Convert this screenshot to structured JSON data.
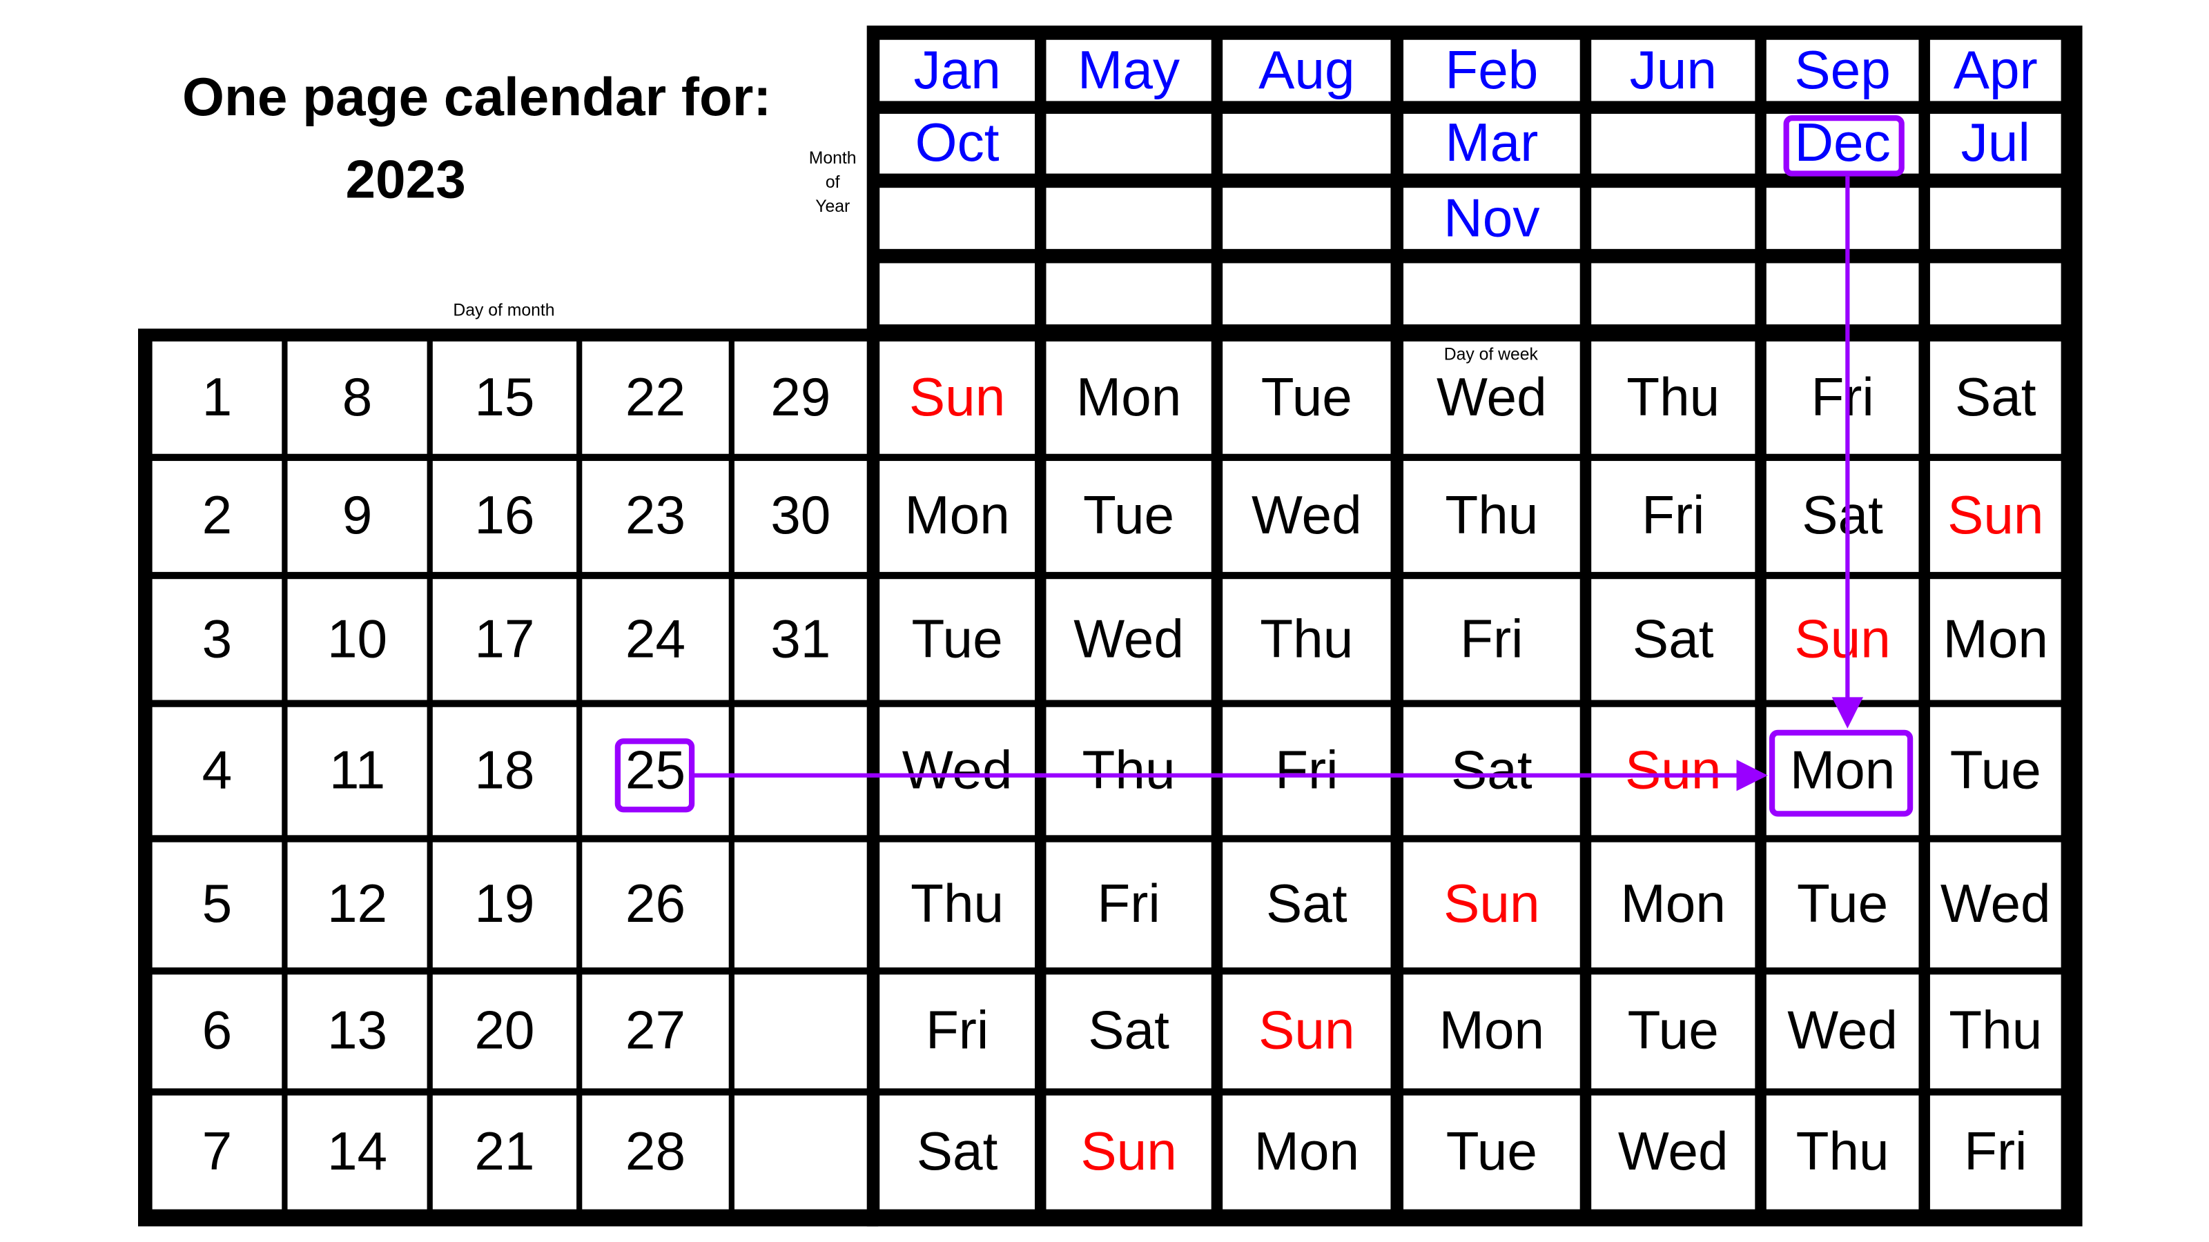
{
  "header": {
    "title": "One page calendar for:",
    "year": "2023"
  },
  "labels": {
    "month_of_year": [
      "Month",
      "of",
      "Year"
    ],
    "day_of_month": "Day of month",
    "day_of_week": "Day of week"
  },
  "colors": {
    "month_text": "#0000ff",
    "sunday": "#ff0000",
    "highlight": "#9900ff",
    "grid": "#000000"
  },
  "months": [
    [
      "Jan",
      "Oct",
      "",
      ""
    ],
    [
      "May",
      "",
      "",
      ""
    ],
    [
      "Aug",
      "",
      "",
      ""
    ],
    [
      "Feb",
      "Mar",
      "Nov",
      ""
    ],
    [
      "Jun",
      "",
      "",
      ""
    ],
    [
      "Sep",
      "Dec",
      "",
      ""
    ],
    [
      "Apr",
      "Jul",
      "",
      ""
    ]
  ],
  "day_numbers": [
    [
      "1",
      "8",
      "15",
      "22",
      "29"
    ],
    [
      "2",
      "9",
      "16",
      "23",
      "30"
    ],
    [
      "3",
      "10",
      "17",
      "24",
      "31"
    ],
    [
      "4",
      "11",
      "18",
      "25",
      ""
    ],
    [
      "5",
      "12",
      "19",
      "26",
      ""
    ],
    [
      "6",
      "13",
      "20",
      "27",
      ""
    ],
    [
      "7",
      "14",
      "21",
      "28",
      ""
    ]
  ],
  "weekdays": [
    [
      "Sun",
      "Mon",
      "Tue",
      "Wed",
      "Thu",
      "Fri",
      "Sat"
    ],
    [
      "Mon",
      "Tue",
      "Wed",
      "Thu",
      "Fri",
      "Sat",
      "Sun"
    ],
    [
      "Tue",
      "Wed",
      "Thu",
      "Fri",
      "Sat",
      "Sun",
      "Mon"
    ],
    [
      "Wed",
      "Thu",
      "Fri",
      "Sat",
      "Sun",
      "Mon",
      "Tue"
    ],
    [
      "Thu",
      "Fri",
      "Sat",
      "Sun",
      "Mon",
      "Tue",
      "Wed"
    ],
    [
      "Fri",
      "Sat",
      "Sun",
      "Mon",
      "Tue",
      "Wed",
      "Thu"
    ],
    [
      "Sat",
      "Sun",
      "Mon",
      "Tue",
      "Wed",
      "Thu",
      "Fri"
    ]
  ],
  "highlight": {
    "day": "25",
    "month": "Dec",
    "weekday": "Mon"
  }
}
